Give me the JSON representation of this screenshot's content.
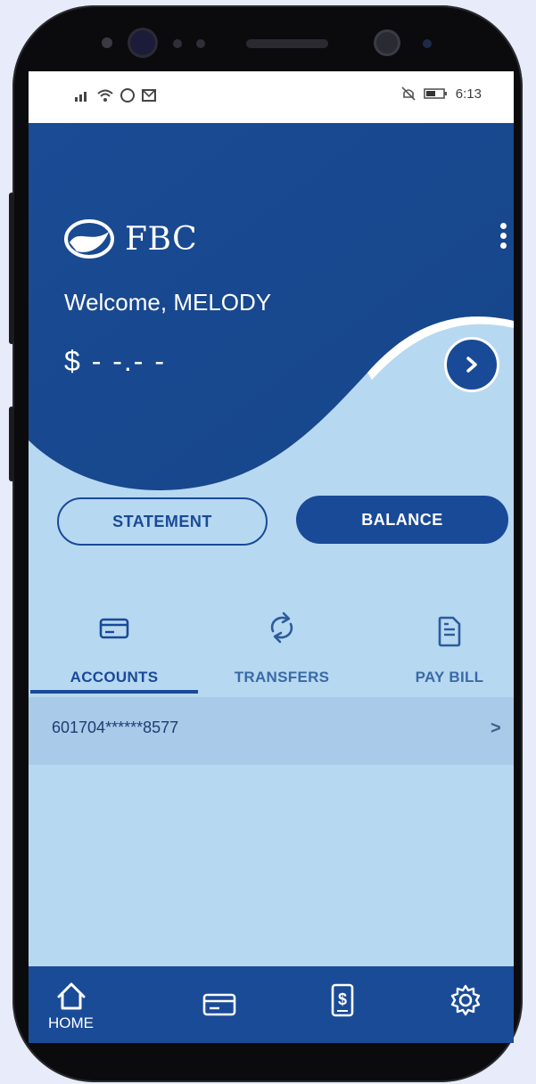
{
  "status_bar": {
    "left_icons": [
      "signal-icon",
      "wifi-icon",
      "whatsapp-icon",
      "message-icon"
    ],
    "right_icons": [
      "mute-icon",
      "battery-icon"
    ],
    "time": "6:13"
  },
  "header": {
    "brand_name": "FBC",
    "welcome_text": "Welcome, MELODY",
    "balance_masked": "$ - -.- -",
    "menu_icon": "kebab-menu-icon",
    "next_icon": "chevron-right-icon"
  },
  "actions": {
    "statement_label": "STATEMENT",
    "balance_label": "BALANCE"
  },
  "tabs": [
    {
      "label": "ACCOUNTS",
      "icon": "card-icon",
      "active": true
    },
    {
      "label": "TRANSFERS",
      "icon": "transfer-icon",
      "active": false
    },
    {
      "label": "PAY BILL",
      "icon": "bill-icon",
      "active": false
    }
  ],
  "accounts": [
    {
      "number": "601704******8577"
    }
  ],
  "bottom_nav": [
    {
      "label": "HOME",
      "icon": "home-icon",
      "active": true
    },
    {
      "label": "",
      "icon": "card-icon"
    },
    {
      "label": "",
      "icon": "dollar-receipt-icon"
    },
    {
      "label": "",
      "icon": "gear-icon"
    }
  ],
  "colors": {
    "primary": "#194a97",
    "hero_blue": "#1a4b94",
    "light_bg": "#b7d8f1",
    "row_bg": "#a9cae9",
    "page_bg": "#e7ebfa"
  }
}
